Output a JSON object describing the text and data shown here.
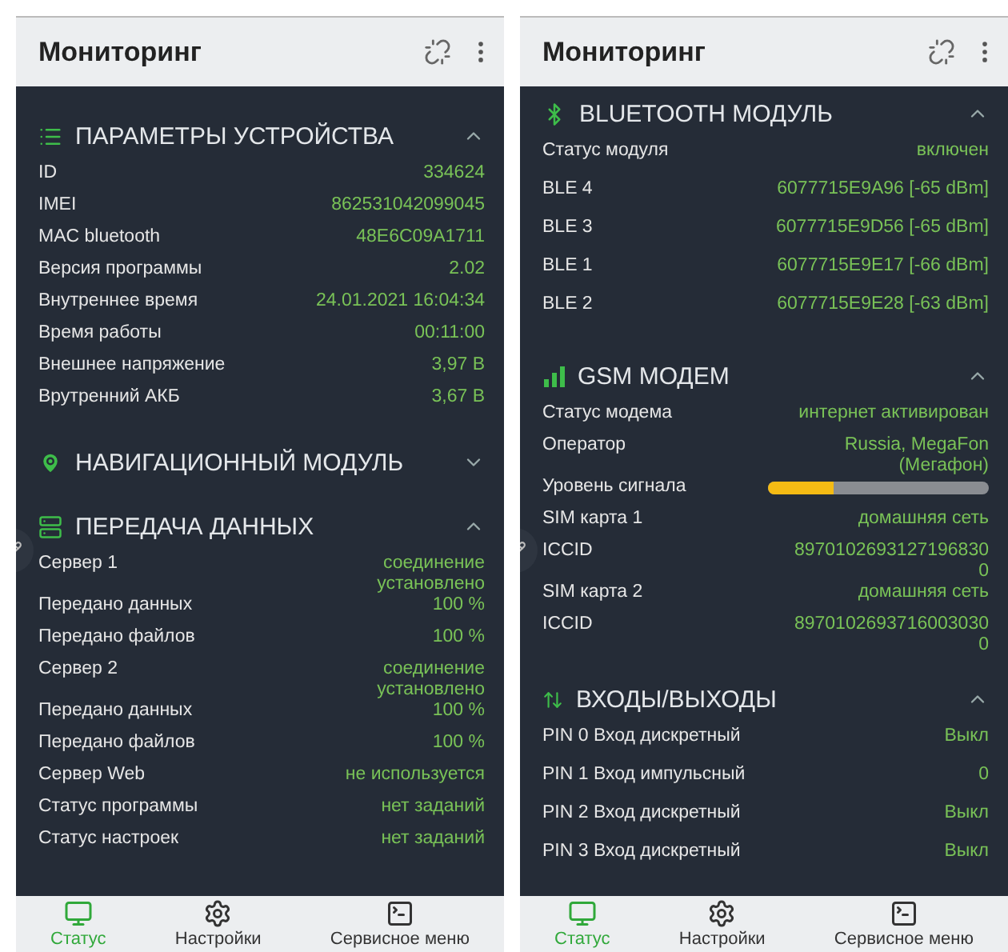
{
  "screens": [
    {
      "title": "Мониторинг",
      "sections": [
        {
          "kind": "list",
          "title": "ПАРАМЕТРЫ УСТРОЙСТВА",
          "expanded": true,
          "rows": [
            {
              "label": "ID",
              "value": "334624"
            },
            {
              "label": "IMEI",
              "value": "862531042099045"
            },
            {
              "label": "MAC bluetooth",
              "value": "48E6C09A1711"
            },
            {
              "label": "Версия программы",
              "value": "2.02"
            },
            {
              "label": "Внутреннее время",
              "value": "24.01.2021 16:04:34"
            },
            {
              "label": "Время работы",
              "value": "00:11:00"
            },
            {
              "label": "Внешнее напряжение",
              "value": "3,97 В"
            },
            {
              "label": "Врутренний АКБ",
              "value": "3,67 В"
            }
          ]
        },
        {
          "kind": "pin",
          "title": "НАВИГАЦИОННЫЙ МОДУЛЬ",
          "expanded": false
        },
        {
          "kind": "transfer",
          "title": "ПЕРЕДАЧА ДАННЫХ",
          "expanded": true,
          "rows": [
            {
              "label": "Сервер 1",
              "value": "соединение установлено"
            },
            {
              "label": "Передано данных",
              "value": "100 %"
            },
            {
              "label": "Передано файлов",
              "value": "100 %"
            },
            {
              "label": "Сервер 2",
              "value": "соединение установлено"
            },
            {
              "label": "Передано данных",
              "value": "100 %"
            },
            {
              "label": "Передано файлов",
              "value": "100 %"
            },
            {
              "label": "Сервер Web",
              "value": "не используется"
            },
            {
              "label": "Статус программы",
              "value": "нет заданий"
            },
            {
              "label": "Статус настроек",
              "value": "нет заданий"
            }
          ]
        }
      ],
      "nav": [
        {
          "kind": "monitor",
          "label": "Статус",
          "selected": true
        },
        {
          "kind": "gear",
          "label": "Настройки",
          "selected": false
        },
        {
          "kind": "terminal",
          "label": "Сервисное меню",
          "selected": false
        }
      ]
    },
    {
      "title": "Мониторинг",
      "sections": [
        {
          "kind": "bluetooth",
          "title": "BLUETOOTH МОДУЛЬ",
          "expanded": true,
          "rows": [
            {
              "label": "Статус модуля",
              "value": "включен"
            },
            {
              "label": "BLE 4",
              "value": "6077715E9A96 [-65 dBm]"
            },
            {
              "label": "BLE 3",
              "value": "6077715E9D56 [-65 dBm]"
            },
            {
              "label": "BLE 1",
              "value": "6077715E9E17 [-66 dBm]"
            },
            {
              "label": "BLE 2",
              "value": "6077715E9E28 [-63 dBm]"
            }
          ]
        },
        {
          "kind": "signal",
          "title": "GSM МОДЕМ",
          "expanded": true,
          "rows": [
            {
              "label": "Статус модема",
              "value": "интернет активирован"
            },
            {
              "label": "Оператор",
              "value": "Russia, MegaFon (Мегафон)"
            },
            {
              "label": "Уровень сигнала",
              "level": 0.3
            },
            {
              "label": "SIM карта 1",
              "value": "домашняя сеть"
            },
            {
              "label": "ICCID",
              "value": "89701026931271968300"
            },
            {
              "label": "SIM карта 2",
              "value": "домашняя сеть"
            },
            {
              "label": "ICCID",
              "value": "89701026937160030300"
            }
          ]
        },
        {
          "kind": "io",
          "title": "ВХОДЫ/ВЫХОДЫ",
          "expanded": true,
          "rows": [
            {
              "label": "PIN 0 Вход дискретный",
              "value": "Выкл"
            },
            {
              "label": "PIN 1 Вход импульсный",
              "value": "0"
            },
            {
              "label": "PIN 2 Вход дискретный",
              "value": "Выкл"
            },
            {
              "label": "PIN 3 Вход дискретный",
              "value": "Выкл"
            }
          ]
        }
      ],
      "nav": [
        {
          "kind": "monitor",
          "label": "Статус",
          "selected": true
        },
        {
          "kind": "gear",
          "label": "Настройки",
          "selected": false
        },
        {
          "kind": "terminal",
          "label": "Сервисное меню",
          "selected": false
        }
      ]
    }
  ]
}
